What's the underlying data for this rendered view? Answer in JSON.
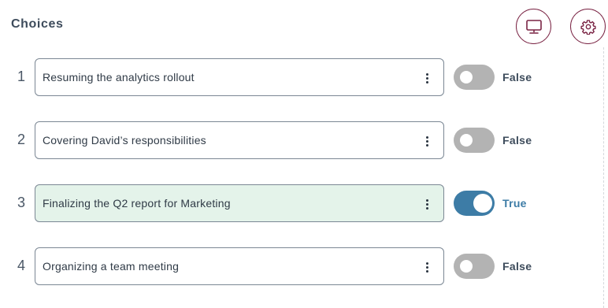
{
  "header": {
    "title": "Choices",
    "monitor_icon": "monitor-icon",
    "settings_icon": "gear-icon"
  },
  "colors": {
    "accent": "#3d7ca6",
    "icon_button_border": "#7a2444",
    "active_row_bg": "#e4f3ea",
    "toggle_off": "#b3b3b3"
  },
  "choices": [
    {
      "number": "1",
      "text": "Resuming the analytics rollout",
      "value": false,
      "value_label": "False"
    },
    {
      "number": "2",
      "text": "Covering David’s responsibilities",
      "value": false,
      "value_label": "False"
    },
    {
      "number": "3",
      "text": "Finalizing the Q2 report for Marketing",
      "value": true,
      "value_label": "True"
    },
    {
      "number": "4",
      "text": "Organizing a team meeting",
      "value": false,
      "value_label": "False"
    }
  ]
}
